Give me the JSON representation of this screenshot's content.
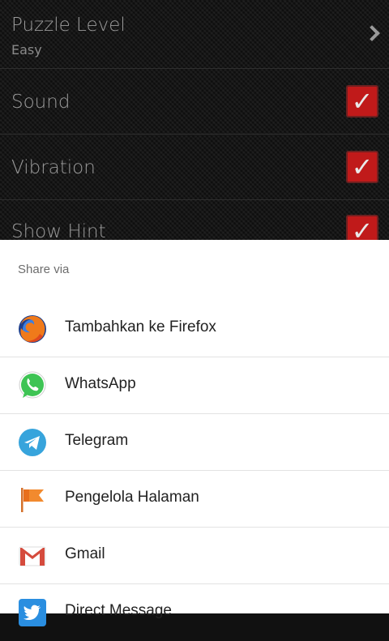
{
  "settings": {
    "puzzle_level": {
      "title": "Puzzle Level",
      "value": "Easy"
    },
    "sound": {
      "title": "Sound",
      "checked": true
    },
    "vibration": {
      "title": "Vibration",
      "checked": true
    },
    "show_hint": {
      "title": "Show Hint",
      "checked": true
    },
    "accent_color": "#c01a1a"
  },
  "share_sheet": {
    "title": "Share via",
    "items": [
      {
        "label": "Tambahkan ke Firefox",
        "icon": "firefox-icon"
      },
      {
        "label": "WhatsApp",
        "icon": "whatsapp-icon"
      },
      {
        "label": "Telegram",
        "icon": "telegram-icon"
      },
      {
        "label": "Pengelola Halaman",
        "icon": "page-manager-flag-icon"
      },
      {
        "label": "Gmail",
        "icon": "gmail-icon"
      },
      {
        "label": "Direct Message",
        "icon": "twitter-icon"
      }
    ]
  }
}
